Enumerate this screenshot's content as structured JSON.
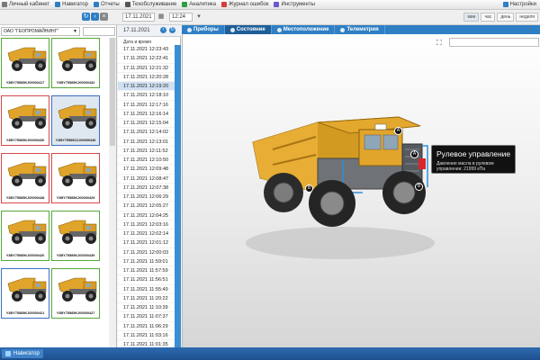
{
  "topmenu": {
    "items": [
      {
        "label": "Личный кабинет",
        "icon": "cabinet-icon",
        "color": "#7a7a7a"
      },
      {
        "label": "Навигатор",
        "icon": "navigator-icon",
        "color": "#2f7fc4"
      },
      {
        "label": "Отчеты",
        "icon": "reports-icon",
        "color": "#2f7fc4"
      },
      {
        "label": "Техобслуживание",
        "icon": "maintenance-icon",
        "color": "#555555"
      },
      {
        "label": "Аналитика",
        "icon": "analytics-icon",
        "color": "#2f9e44"
      },
      {
        "label": "Журнал ошибок",
        "icon": "error-log-icon",
        "color": "#d43f3a"
      },
      {
        "label": "Инструменты",
        "icon": "tools-icon",
        "color": "#6a5acd"
      }
    ],
    "right_label": "Настройки",
    "right_icon": "settings-icon"
  },
  "toolbar": {
    "date_value": "17.11.2021",
    "time_value": "12:24",
    "period_buttons": [
      "мин",
      "час",
      "день",
      "неделя"
    ],
    "active_period": 0
  },
  "left": {
    "org_select": "ОАО \"ГЕОПРОМАЙНИНГ\"",
    "cards": [
      {
        "id": "Y3BY75585KJ00000417",
        "status": "green"
      },
      {
        "id": "Y3BY75585KJ00000432",
        "status": "green"
      },
      {
        "id": "Y3BY75585KJ00000430",
        "status": "red"
      },
      {
        "id": "Y3BY75585C2J00000436",
        "status": "blue",
        "selected": true
      },
      {
        "id": "Y3BY75585KJ00000448",
        "status": "red"
      },
      {
        "id": "Y3BY75585KJ00000429",
        "status": "red"
      },
      {
        "id": "Y3BY75585KJ00000420",
        "status": "green"
      },
      {
        "id": "Y3BY75585KJ00000439",
        "status": "green"
      },
      {
        "id": "Y3BY75585KJ00000421",
        "status": "blue"
      },
      {
        "id": "Y3BY75585KJ00000427",
        "status": "green"
      }
    ]
  },
  "middle": {
    "header": "17.11.2021",
    "column": "Дата и время",
    "rows": [
      "17.11.2021 12:23:43",
      "17.11.2021 12:22:41",
      "17.11.2021 12:21:32",
      "17.11.2021 12:20:28",
      "17.11.2021 12:19:20",
      "17.11.2021 12:18:10",
      "17.11.2021 12:17:16",
      "17.11.2021 12:16:14",
      "17.11.2021 12:15:04",
      "17.11.2021 12:14:02",
      "17.11.2021 12:13:01",
      "17.11.2021 12:11:52",
      "17.11.2021 12:10:50",
      "17.11.2021 12:09:48",
      "17.11.2021 12:08:47",
      "17.11.2021 12:07:38",
      "17.11.2021 12:06:29",
      "17.11.2021 12:05:27",
      "17.11.2021 12:04:25",
      "17.11.2021 12:03:16",
      "17.11.2021 12:02:14",
      "17.11.2021 12:01:12",
      "17.11.2021 12:00:03",
      "17.11.2021 11:59:01",
      "17.11.2021 11:57:59",
      "17.11.2021 11:56:51",
      "17.11.2021 11:55:49",
      "17.11.2021 11:20:22",
      "17.11.2021 11:10:39",
      "17.11.2021 11:07:37",
      "17.11.2021 11:06:29",
      "17.11.2021 11:03:16",
      "17.11.2021 11:01:35"
    ],
    "selected_row": 4
  },
  "right": {
    "tabs": [
      {
        "label": "Приборы",
        "icon": "gauges-icon"
      },
      {
        "label": "Состояние",
        "icon": "state-icon",
        "active": true
      },
      {
        "label": "Местоположение",
        "icon": "location-icon"
      },
      {
        "label": "Телеметрия",
        "icon": "telemetry-icon"
      }
    ],
    "tooltip": {
      "title": "Рулевое управление",
      "body": "Давление масла в рулевом управлении: 21999 кПа"
    },
    "markers": [
      "A",
      "A",
      "B",
      "B"
    ]
  },
  "taskbar": {
    "items": [
      {
        "label": "Навигатор",
        "icon": "navigator-icon"
      }
    ]
  }
}
